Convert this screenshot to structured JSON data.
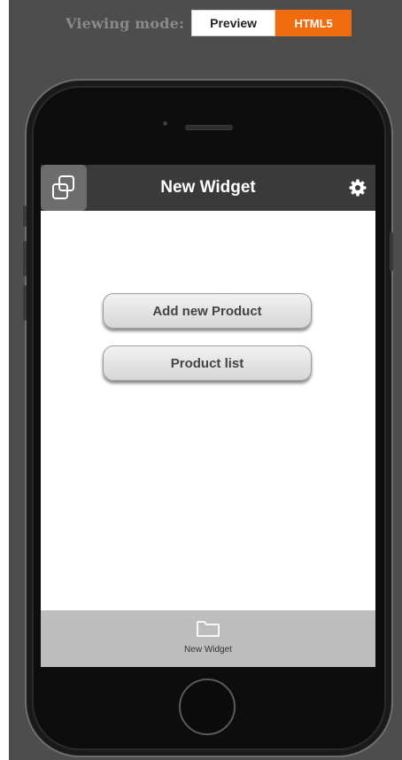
{
  "viewing_mode": {
    "label": "Viewing mode:",
    "options": [
      "Preview",
      "HTML5"
    ],
    "selected": "HTML5",
    "accent_color": "#f06c0f"
  },
  "app": {
    "title": "New Widget",
    "header_icon": "app-switch-icon",
    "settings_icon": "gear-icon"
  },
  "main": {
    "buttons": [
      {
        "label": "Add new Product"
      },
      {
        "label": "Product list"
      }
    ]
  },
  "tabbar": {
    "items": [
      {
        "label": "New Widget",
        "icon": "folder-icon"
      }
    ]
  }
}
